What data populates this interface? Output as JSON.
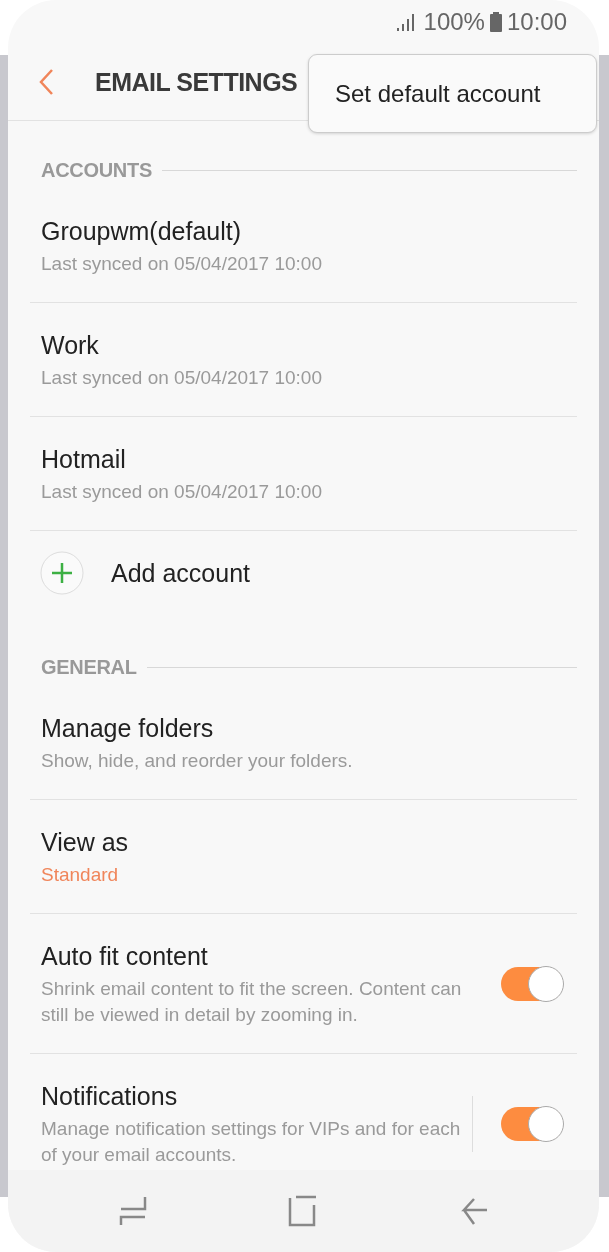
{
  "status_bar": {
    "battery": "100%",
    "time": "10:00"
  },
  "header": {
    "title": "EMAIL SETTINGS"
  },
  "menu": {
    "items": [
      "Set default account"
    ]
  },
  "sections": [
    {
      "title": "ACCOUNTS",
      "items": [
        {
          "kind": "account",
          "title": "Groupwm(default)",
          "subtitle": "Last synced on 05/04/2017  10:00"
        },
        {
          "kind": "account",
          "title": "Work",
          "subtitle": "Last synced on 05/04/2017  10:00"
        },
        {
          "kind": "account",
          "title": "Hotmail",
          "subtitle": "Last synced on 05/04/2017  10:00"
        },
        {
          "kind": "add",
          "title": "Add account"
        }
      ]
    },
    {
      "title": "GENERAL",
      "items": [
        {
          "kind": "setting",
          "title": "Manage folders",
          "subtitle": "Show, hide, and reorder your folders."
        },
        {
          "kind": "value",
          "title": "View as",
          "subtitle": "Standard"
        },
        {
          "kind": "toggle",
          "title": "Auto fit content",
          "subtitle": "Shrink email content to fit the screen. Content can still be viewed in detail by zooming in.",
          "on": true
        },
        {
          "kind": "split_toggle",
          "title": "Notifications",
          "subtitle": "Manage notification settings for VIPs and for each of your email accounts.",
          "on": true
        }
      ]
    }
  ]
}
